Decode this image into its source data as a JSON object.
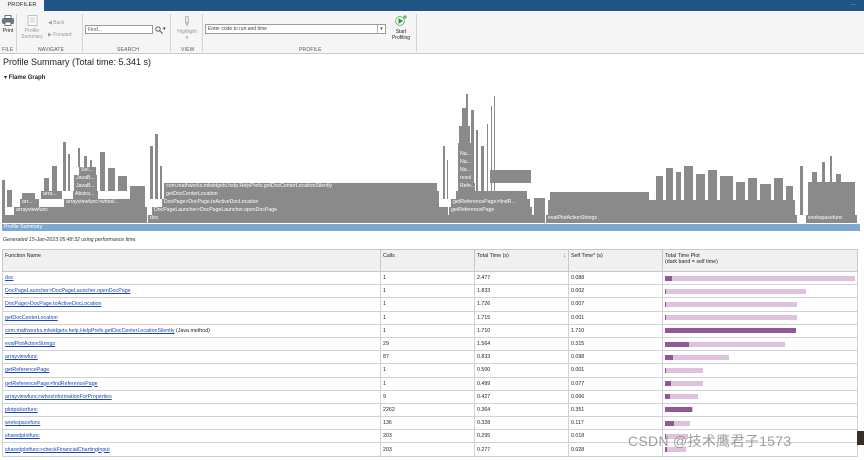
{
  "tabbar": {
    "active_tab": "PROFILER",
    "more": "···"
  },
  "toolstrip": {
    "print": "Print",
    "profile_summary_1": "Profile",
    "profile_summary_2": "Summary",
    "back": "Back",
    "forward": "Forward",
    "find_value": "Find...",
    "highlight": "Highlight",
    "code_placeholder": "Enter code to run and time",
    "start_profiling_1": "Start",
    "start_profiling_2": "Profiling",
    "sections": {
      "file": "FILE",
      "navigate": "NAVIGATE",
      "search": "SEARCH",
      "view": "VIEW",
      "profile": "PROFILE"
    }
  },
  "title": "Profile Summary (Total time: 5.341 s)",
  "flame_header": "Flame Graph",
  "flame": {
    "summary_label": "Profile Summary",
    "labels": {
      "arrayviewfunc_1": "arrayviewfunc",
      "arr_1": "arr...",
      "arra_1": "arra...",
      "arra_2": "arra...",
      "arrayviewfunc_whosi": "arrayviewfunc>whosI...",
      "abstra": "Abstra...",
      "javab_1": "JavaB...",
      "javab_2": "JavaB...",
      "sel": "Sel...",
      "doc": "doc",
      "docpage_launcher": "DocPageLauncher>DocPageLauncher.openDocPage",
      "docpage_active": "DocPage>DocPage.toActiveDocLocation",
      "get_doc_center": "getDocCenterLocation",
      "com_mathworks": "com.mathworks.mlwidgets.help.HelpPrefs.getDocCenterLocationSilently",
      "get_reference_page": "getReferencePage",
      "get_reference_find": "getReferencePage>findR...",
      "refe": "Refe...",
      "resol": "resol...",
      "na_1": "Na...",
      "na_2": "Na...",
      "na_3": "Na...",
      "eval_plot": "evalPlotActionStrings",
      "workspacefunc": "workspacefunc"
    }
  },
  "generated": "Generated 15-Jan-2023 05:48:32 using performance time.",
  "table": {
    "headers": {
      "function_name": "Function Name",
      "calls": "Calls",
      "total_time": "Total Time (s)",
      "sort_arrow": "↓",
      "self_time": "Self Time* (s)",
      "plot_1": "Total Time Plot",
      "plot_2": "(dark band = self time)"
    },
    "rows": [
      {
        "name": "doc",
        "suffix": "",
        "calls": "1",
        "total": "2.477",
        "self": "0.088",
        "total_v": 2.477,
        "self_v": 0.088
      },
      {
        "name": "DocPageLauncher>DocPageLauncher.openDocPage",
        "suffix": "",
        "calls": "1",
        "total": "1.833",
        "self": "0.002",
        "total_v": 1.833,
        "self_v": 0.002
      },
      {
        "name": "DocPage>DocPage.toActiveDocLocation",
        "suffix": "",
        "calls": "1",
        "total": "1.726",
        "self": "0.007",
        "total_v": 1.726,
        "self_v": 0.007
      },
      {
        "name": "getDocCenterLocation",
        "suffix": "",
        "calls": "1",
        "total": "1.715",
        "self": "0.001",
        "total_v": 1.715,
        "self_v": 0.001
      },
      {
        "name": "com.mathworks.mlwidgets.help.HelpPrefs.getDocCenterLocationSilently",
        "suffix": " (Java method)",
        "calls": "1",
        "total": "1.710",
        "self": "1.710",
        "total_v": 1.71,
        "self_v": 1.71
      },
      {
        "name": "evalPlotActionStrings",
        "suffix": "",
        "calls": "29",
        "total": "1.564",
        "self": "0.315",
        "total_v": 1.564,
        "self_v": 0.315
      },
      {
        "name": "arrayviewfunc",
        "suffix": "",
        "calls": "87",
        "total": "0.833",
        "self": "0.098",
        "total_v": 0.833,
        "self_v": 0.098
      },
      {
        "name": "getReferencePage",
        "suffix": "",
        "calls": "1",
        "total": "0.500",
        "self": "0.001",
        "total_v": 0.5,
        "self_v": 0.001
      },
      {
        "name": "getReferencePage>findReferencePage",
        "suffix": "",
        "calls": "1",
        "total": "0.499",
        "self": "0.077",
        "total_v": 0.499,
        "self_v": 0.077
      },
      {
        "name": "arrayviewfunc>whosInformationForProperties",
        "suffix": "",
        "calls": "9",
        "total": "0.427",
        "self": "0.066",
        "total_v": 0.427,
        "self_v": 0.066
      },
      {
        "name": "plotpickerfunc",
        "suffix": "",
        "calls": "2262",
        "total": "0.364",
        "self": "0.351",
        "total_v": 0.364,
        "self_v": 0.351
      },
      {
        "name": "workspacefunc",
        "suffix": "",
        "calls": "136",
        "total": "0.328",
        "self": "0.117",
        "total_v": 0.328,
        "self_v": 0.117
      },
      {
        "name": "sharedplotfunc",
        "suffix": "",
        "calls": "203",
        "total": "0.295",
        "self": "0.018",
        "total_v": 0.295,
        "self_v": 0.018
      },
      {
        "name": "sharedplotfunc>checkFinancialChartingInput",
        "suffix": "",
        "calls": "203",
        "total": "0.277",
        "self": "0.028",
        "total_v": 0.277,
        "self_v": 0.028
      }
    ]
  },
  "watermark": "CSDN @技术鹰君子1573",
  "colors": {
    "accent": "#1e5586",
    "flame_block": "#8a8a8a",
    "summary_bar": "#7fa8d1",
    "plot_light": "#dcc2dc",
    "plot_dark": "#955695",
    "link": "#1a47b8"
  }
}
